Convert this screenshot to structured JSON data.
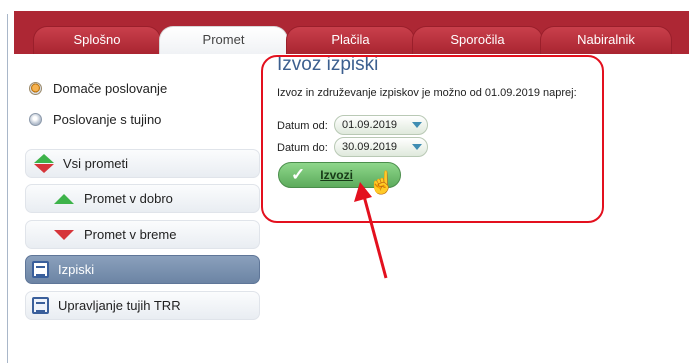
{
  "tabs": [
    {
      "label": "Splošno",
      "active": false
    },
    {
      "label": "Promet",
      "active": true
    },
    {
      "label": "Plačila",
      "active": false
    },
    {
      "label": "Sporočila",
      "active": false
    },
    {
      "label": "Nabiralnik",
      "active": false
    }
  ],
  "sidebar": {
    "radios": [
      {
        "label": "Domače poslovanje",
        "checked": true
      },
      {
        "label": "Poslovanje s tujino",
        "checked": false
      }
    ],
    "items": [
      {
        "label": "Vsi prometi",
        "icon": "up-down-arrows-icon"
      },
      {
        "label": "Promet v dobro",
        "icon": "green-up-arrow-icon"
      },
      {
        "label": "Promet v breme",
        "icon": "red-down-arrow-icon"
      },
      {
        "label": "Izpiski",
        "icon": "document-list-icon",
        "selected": true
      },
      {
        "label": "Upravljanje tujih TRR",
        "icon": "document-list-icon"
      }
    ]
  },
  "export_panel": {
    "title": "Izvoz izpiski",
    "description": "Izvoz in združevanje izpiskov je možno od 01.09.2019 naprej:",
    "date_from_label": "Datum od:",
    "date_from_value": "01.09.2019",
    "date_to_label": "Datum do:",
    "date_to_value": "30.09.2019",
    "export_button_label": "Izvozi"
  },
  "colors": {
    "tabbar": "#ad2734",
    "selected_item": "#6c84a4",
    "export_button": "#5dab5c",
    "annotation": "#e3101e"
  }
}
